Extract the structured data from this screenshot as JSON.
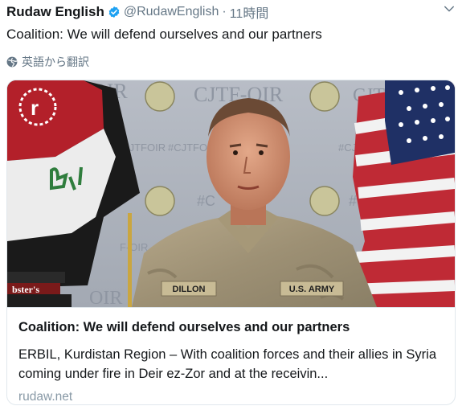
{
  "tweet": {
    "display_name": "Rudaw English",
    "handle": "@RudawEnglish",
    "separator": "·",
    "time": "11時間",
    "text": "Coalition: We will defend ourselves and our partners",
    "translate_label": "英語から翻訳"
  },
  "card": {
    "image_overlay": {
      "backdrop_text": [
        "CJTF-OIR",
        "#CJTFOIR",
        "#CJTFOIR",
        "#CJTFOIR",
        "F-OIR",
        "OIR"
      ],
      "name_tape": "DILLON",
      "branch_tape": "U.S. ARMY",
      "book_text": "bster's"
    },
    "title": "Coalition: We will defend ourselves and our partners",
    "description": "ERBIL, Kurdistan Region – With coalition forces and their allies in Syria coming under fire in Deir ez-Zor and at the receivin...",
    "domain": "rudaw.net"
  },
  "colors": {
    "text_primary": "#14171a",
    "text_secondary": "#657786",
    "verified_blue": "#1da1f2",
    "border": "#e1e8ed"
  },
  "icons": {
    "verified": "verified-badge-icon",
    "chevron": "chevron-down-icon",
    "globe": "globe-icon",
    "logo": "rudaw-logo-icon"
  }
}
